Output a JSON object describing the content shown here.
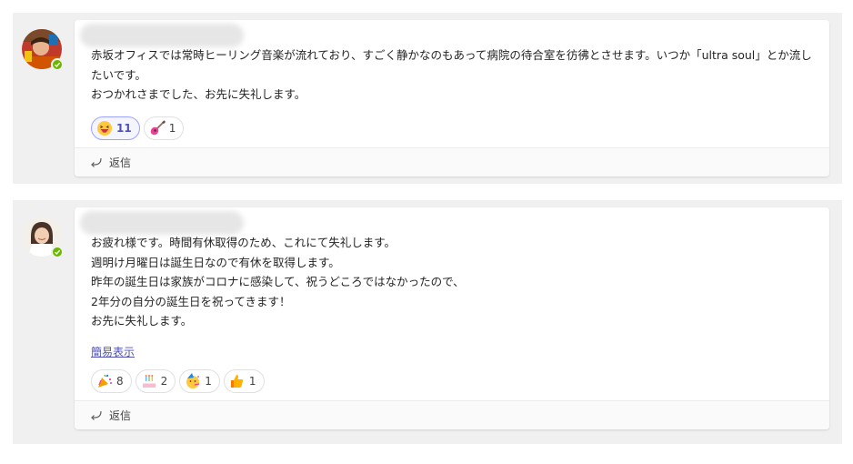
{
  "messages": [
    {
      "lines": [
        "赤坂オフィスでは常時ヒーリング音楽が流れており、すごく静かなのもあって病院の待合室を彷彿とさせます。いつか「ultra soul」とか流し",
        "たいです。",
        "おつかれさまでした、お先に失礼します。"
      ],
      "reactions": [
        {
          "icon": "laughing-face-icon",
          "count": "11",
          "selected": true
        },
        {
          "icon": "guitar-icon",
          "count": "1",
          "selected": false
        }
      ],
      "reply_label": "返信"
    },
    {
      "lines": [
        "お疲れ様です。時間有休取得のため、これにて失礼します。",
        "週明け月曜日は誕生日なので有休を取得します。",
        "昨年の誕生日は家族がコロナに感染して、祝うどころではなかったので、",
        "2年分の自分の誕生日を祝ってきます！",
        "お先に失礼します。"
      ],
      "show_less_label": "簡易表示",
      "reactions": [
        {
          "icon": "party-popper-icon",
          "count": "8",
          "selected": false
        },
        {
          "icon": "birthday-cake-icon",
          "count": "2",
          "selected": false
        },
        {
          "icon": "partying-face-icon",
          "count": "1",
          "selected": false
        },
        {
          "icon": "thumbs-up-icon",
          "count": "1",
          "selected": false
        }
      ],
      "reply_label": "返信"
    }
  ],
  "colors": {
    "presence": "#6bb700",
    "link": "#4f52b2",
    "selected_reaction_border": "#9ea2ff"
  }
}
